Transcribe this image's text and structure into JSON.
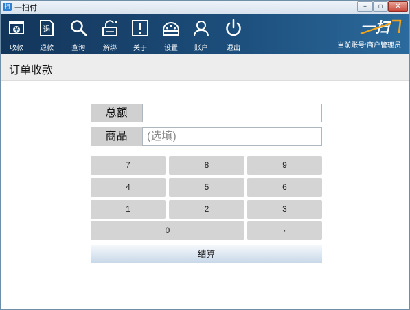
{
  "window": {
    "title": "一扫付",
    "app_icon_text": "扫",
    "controls": {
      "minimize": "–",
      "maximize": "▫",
      "close": "✕"
    }
  },
  "toolbar": {
    "items": [
      {
        "label": "收款",
        "icon": "receive-payment-icon"
      },
      {
        "label": "退款",
        "icon": "refund-icon"
      },
      {
        "label": "查询",
        "icon": "search-icon"
      },
      {
        "label": "解绑",
        "icon": "unbind-icon"
      },
      {
        "label": "关于",
        "icon": "info-icon"
      },
      {
        "label": "设置",
        "icon": "settings-icon"
      },
      {
        "label": "账户",
        "icon": "user-icon"
      },
      {
        "label": "退出",
        "icon": "power-icon"
      }
    ],
    "refund_icon_char": "退",
    "logo_text": "一扫",
    "account_text": "当前账号:商户管理员"
  },
  "page": {
    "title": "订单收款"
  },
  "form": {
    "total_label": "总额",
    "total_value": "",
    "goods_label": "商品",
    "goods_placeholder": "(选填)"
  },
  "keypad": {
    "rows": [
      [
        "7",
        "8",
        "9"
      ],
      [
        "4",
        "5",
        "6"
      ],
      [
        "1",
        "2",
        "3"
      ],
      [
        "0",
        "·"
      ]
    ],
    "checkout_label": "结算"
  },
  "colors": {
    "toolbar_start": "#13355a",
    "toolbar_end": "#2b6a9c",
    "key_bg": "#d4d4d4",
    "label_bg": "#d0d0d0",
    "logo_accent": "#f2a51a"
  }
}
